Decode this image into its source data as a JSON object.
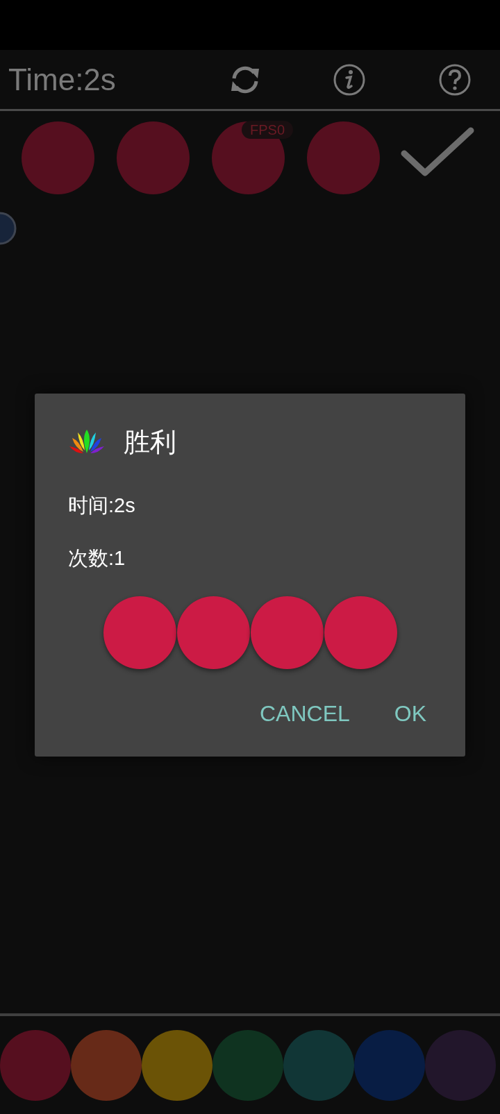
{
  "top_bar": {
    "time": "Time:2s"
  },
  "board": {
    "fps": "FPS0",
    "slots": [
      {
        "color": "#560f1f"
      },
      {
        "color": "#560f1f"
      },
      {
        "color": "#560f1f"
      },
      {
        "color": "#560f1f"
      }
    ]
  },
  "dialog": {
    "title": "胜利",
    "lines": [
      "时间:2s",
      "次数:1"
    ],
    "slots": [
      {
        "color": "#cc1b45"
      },
      {
        "color": "#cc1b45"
      },
      {
        "color": "#cc1b45"
      },
      {
        "color": "#cc1b45"
      }
    ],
    "buttons": [
      "CANCEL",
      "OK"
    ]
  },
  "palette": [
    {
      "color": "#560f1f"
    },
    {
      "color": "#672a18"
    },
    {
      "color": "#6b5306"
    },
    {
      "color": "#0f3320"
    },
    {
      "color": "#113636"
    },
    {
      "color": "#081d44"
    },
    {
      "color": "#22162b"
    }
  ]
}
